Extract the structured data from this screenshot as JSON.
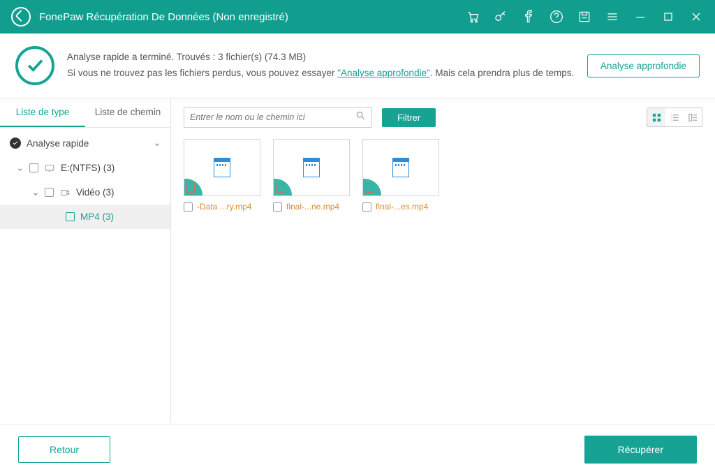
{
  "app": {
    "title": "FonePaw Récupération De Données (Non enregistré)"
  },
  "status": {
    "line1": "Analyse rapide a terminé. Trouvés : 3 fichier(s) (74.3 MB)",
    "line2_pre": "Si vous ne trouvez pas les fichiers perdus, vous pouvez essayer ",
    "line2_link": "\"Analyse approfondie\"",
    "line2_post": ". Mais cela prendra plus de temps."
  },
  "buttons": {
    "deep_scan": "Analyse approfondie",
    "filter": "Filtrer",
    "back": "Retour",
    "recover": "Récupérer"
  },
  "tabs": {
    "type": "Liste de type",
    "path": "Liste de chemin"
  },
  "search": {
    "placeholder": "Entrer le nom ou le chemin ici"
  },
  "tree": {
    "quick_scan": "Analyse rapide",
    "drive": "E:(NTFS) (3)",
    "video": "Vidéo (3)",
    "mp4": "MP4 (3)"
  },
  "files": [
    {
      "name": "-Data ...ry.mp4"
    },
    {
      "name": "final-...ne.mp4"
    },
    {
      "name": "final-...es.mp4"
    }
  ]
}
